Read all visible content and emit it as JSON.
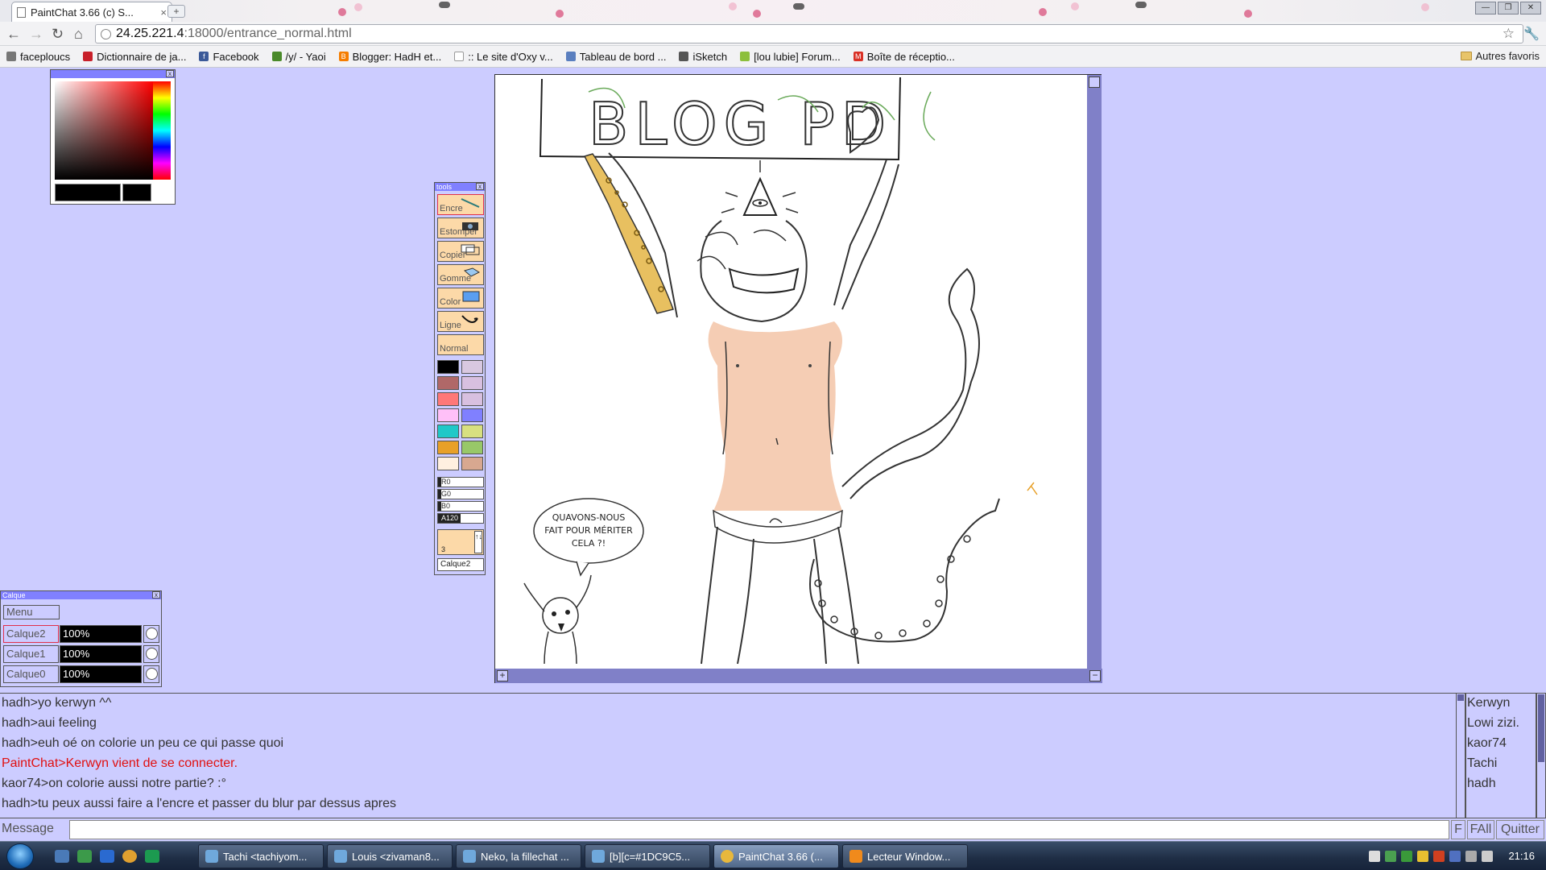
{
  "browser": {
    "tab_title": "PaintChat 3.66 (c) S...",
    "tab_close": "×",
    "new_tab": "+",
    "window_buttons": [
      "—",
      "❐",
      "✕"
    ],
    "url_host": "24.25.221.4",
    "url_path": ":18000/entrance_normal.html",
    "back": "←",
    "forward": "→",
    "reload": "↻",
    "home": "⌂",
    "star": "☆",
    "wrench": "🔧",
    "bookmarks": [
      {
        "label": "faceploucs",
        "icon": "#777"
      },
      {
        "label": "Dictionnaire de ja...",
        "icon": "#c8202a"
      },
      {
        "label": "Facebook",
        "icon": "#3b5998"
      },
      {
        "label": "/y/ - Yaoi",
        "icon": "#4a8a2a"
      },
      {
        "label": "Blogger: HadH et...",
        "icon": "#f57d00"
      },
      {
        "label": ":: Le site d'Oxy v...",
        "icon": "#aaaaaa"
      },
      {
        "label": "Tableau de bord ...",
        "icon": "#5a7fbf"
      },
      {
        "label": "iSketch",
        "icon": "#555555"
      },
      {
        "label": "[lou lubie] Forum...",
        "icon": "#8cbf3c"
      },
      {
        "label": "Boîte de réceptio...",
        "icon": "#d93025"
      }
    ],
    "other_bookmarks": "Autres favoris"
  },
  "tools": {
    "title": "tools",
    "buttons": [
      {
        "label": "Encre",
        "selected": true
      },
      {
        "label": "Estomper",
        "selected": false
      },
      {
        "label": "Copier",
        "selected": false
      },
      {
        "label": "Gomme",
        "selected": false
      },
      {
        "label": "Color",
        "selected": false
      },
      {
        "label": "Ligne",
        "selected": false
      },
      {
        "label": "Normal",
        "selected": false
      }
    ],
    "swatches": [
      "#000000",
      "#d8c8e0",
      "#b06868",
      "#d8c0e0",
      "#ff7878",
      "#d8c0e0",
      "#ffc0f8",
      "#8080ff",
      "#20c8c8",
      "#d8e080",
      "#e8a028",
      "#98c868",
      "#fff0e0",
      "#d8a890"
    ],
    "rgb": [
      {
        "label": "R0"
      },
      {
        "label": "G0"
      },
      {
        "label": "B0"
      },
      {
        "label": "A120"
      }
    ],
    "size": "3",
    "size_arrows": "↑↓",
    "current_layer": "Calque2"
  },
  "layers": {
    "title": "Calque",
    "menu": "Menu",
    "rows": [
      {
        "name": "Calque2",
        "opacity": "100%",
        "selected": true
      },
      {
        "name": "Calque1",
        "opacity": "100%",
        "selected": false
      },
      {
        "name": "Calque0",
        "opacity": "100%",
        "selected": false
      }
    ]
  },
  "drawing": {
    "banner_text": "BLOG PD",
    "speech_bubble_line1": "QUAVONS-NOUS",
    "speech_bubble_line2": "FAIT POUR MÉRITER",
    "speech_bubble_line3": "CELA ?!",
    "colors": {
      "skin": "#f5cdb4",
      "leopard": "#e8c060",
      "sketch": "#6aaa5a"
    }
  },
  "chat": {
    "messages": [
      {
        "text": "hadh>yo kerwyn ^^",
        "system": false
      },
      {
        "text": "hadh>aui feeling",
        "system": false
      },
      {
        "text": "hadh>euh oé on colorie un peu ce qui passe quoi",
        "system": false
      },
      {
        "text": "PaintChat>Kerwyn vient de se connecter.",
        "system": true
      },
      {
        "text": "kaor74>on colorie aussi notre partie? :°",
        "system": false
      },
      {
        "text": "hadh>tu peux aussi faire a l'encre et passer du blur par dessus apres",
        "system": false
      }
    ],
    "users": [
      "Kerwyn",
      "Lowi zizi.",
      "kaor74",
      "Tachi",
      "hadh"
    ],
    "message_label": "Message",
    "message_value": "",
    "buttons": [
      "F",
      "FAll",
      "Quitter"
    ]
  },
  "taskbar": {
    "items": [
      {
        "label": "Tachi <tachiyom...",
        "active": false,
        "icon": "#6fa8dc"
      },
      {
        "label": "Louis <zivaman8...",
        "active": false,
        "icon": "#6fa8dc"
      },
      {
        "label": "Neko, la fillechat ...",
        "active": false,
        "icon": "#6fa8dc"
      },
      {
        "label": "[b][c=#1DC9C5...",
        "active": false,
        "icon": "#6fa8dc"
      },
      {
        "label": "PaintChat 3.66 (...",
        "active": true,
        "icon": "#e8b83c"
      },
      {
        "label": "Lecteur Window...",
        "active": false,
        "icon": "#f08a1c"
      }
    ],
    "clock": "21:16"
  }
}
